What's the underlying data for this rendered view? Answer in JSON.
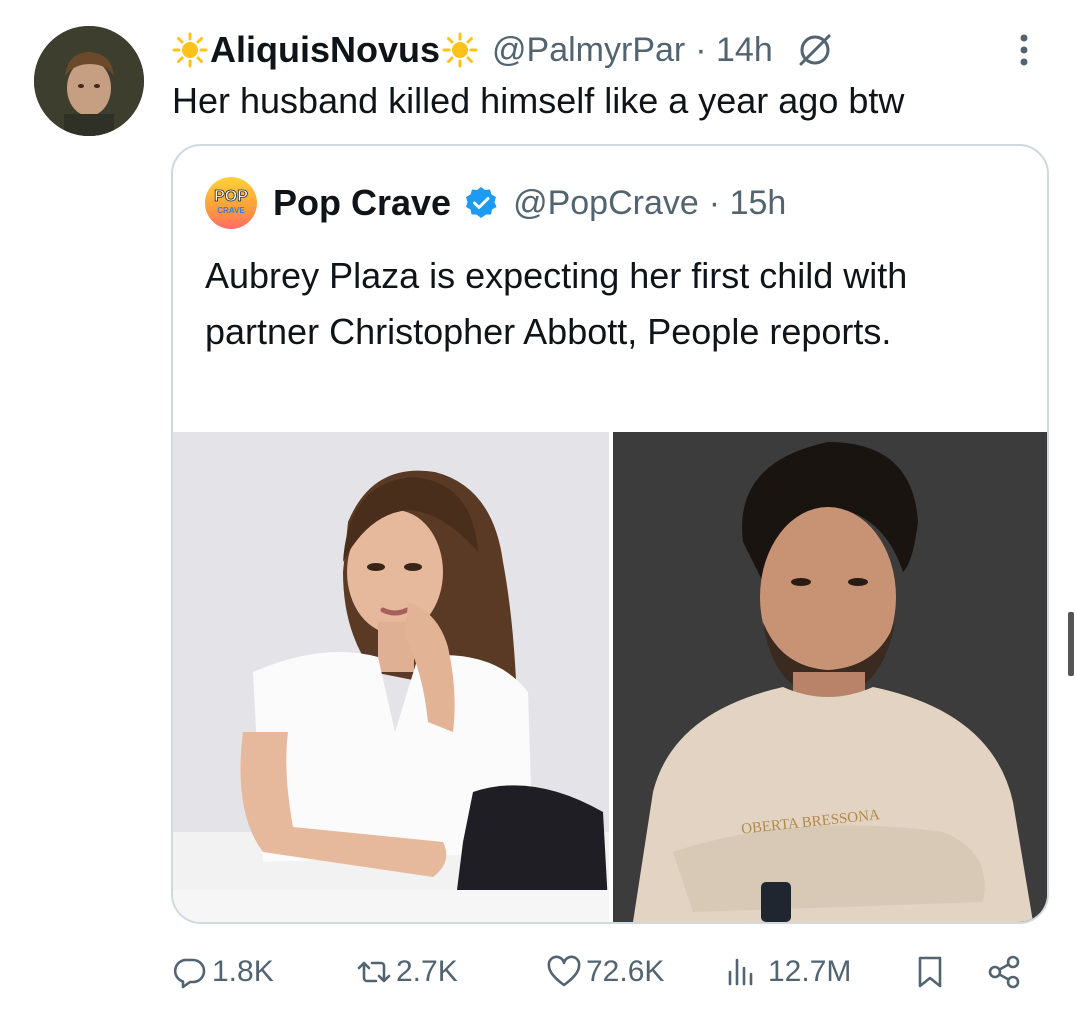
{
  "tweet": {
    "display_name": "AliquisNovus",
    "handle": "@PalmyrPar",
    "time": "· 14h",
    "text": "Her husband killed himself like a year ago btw"
  },
  "quoted_tweet": {
    "display_name": "Pop Crave",
    "logo_text_top": "POP",
    "logo_text_bottom": "CRAVE",
    "handle": "@PopCrave",
    "time": "· 15h",
    "text": "Aubrey Plaza is expecting her first child with partner Christopher Abbott, People reports.",
    "sweater_text": "OBERTA  BRESSONA"
  },
  "actions": {
    "replies": "1.8K",
    "reposts": "2.7K",
    "likes": "72.6K",
    "views": "12.7M"
  },
  "colors": {
    "muted_text": "#536471",
    "verified": "#1d9bf0",
    "sun": "#ffc21a",
    "border": "#cfd9de"
  },
  "icons": [
    "sun-icon",
    "muted-icon",
    "more-icon",
    "verified-badge-icon",
    "reply-icon",
    "repost-icon",
    "like-icon",
    "views-icon",
    "bookmark-icon",
    "share-icon"
  ]
}
